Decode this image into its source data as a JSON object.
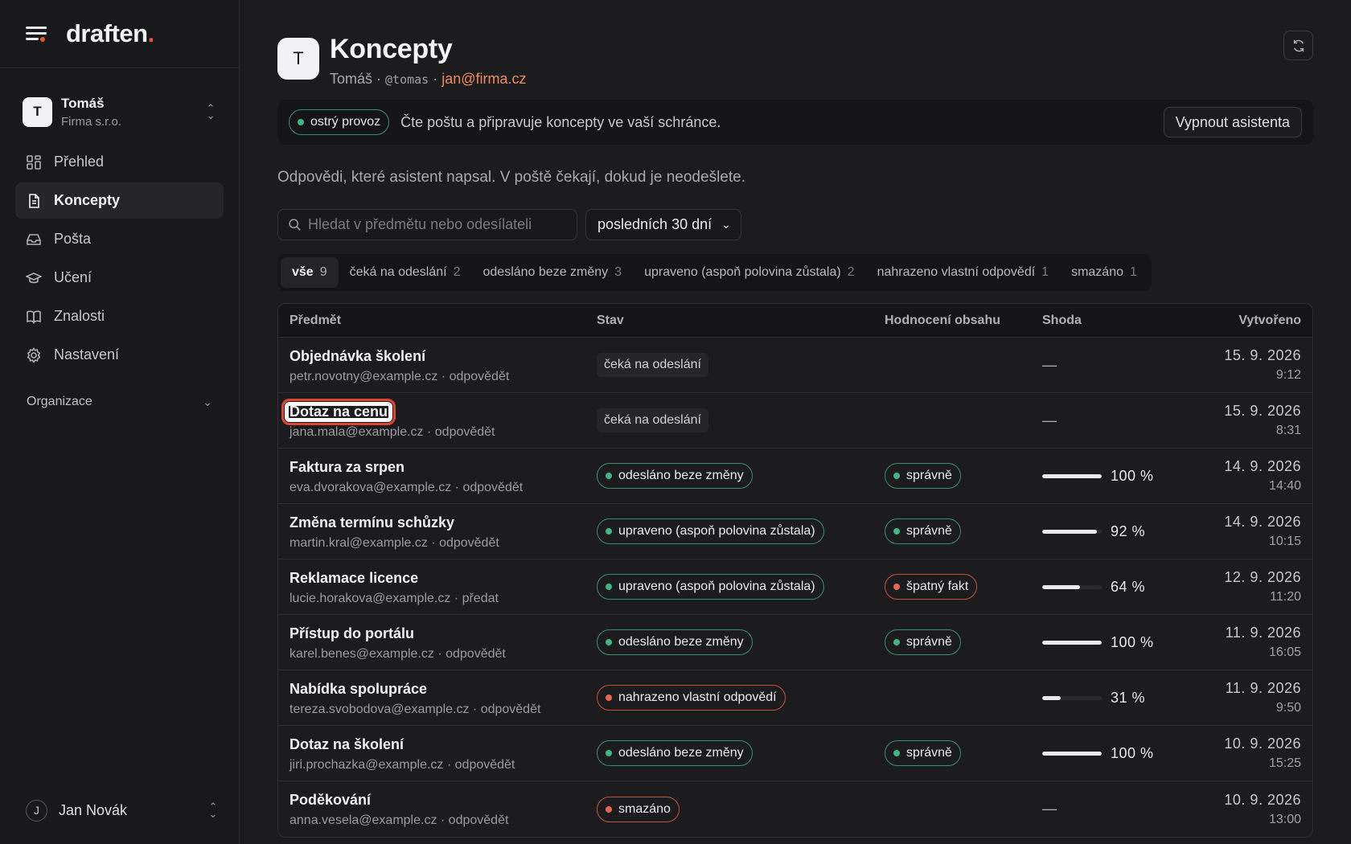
{
  "app": {
    "logo_text": "draften",
    "logo_accent": ".",
    "accent_color": "#e8552f"
  },
  "account": {
    "initial": "T",
    "name": "Tomáš",
    "org": "Firma s.r.o."
  },
  "nav": [
    {
      "label": "Přehled",
      "icon": "grid-icon"
    },
    {
      "label": "Koncepty",
      "icon": "document-icon",
      "active": true
    },
    {
      "label": "Pošta",
      "icon": "inbox-icon"
    },
    {
      "label": "Učení",
      "icon": "graduation-cap-icon"
    },
    {
      "label": "Znalosti",
      "icon": "book-icon"
    },
    {
      "label": "Nastavení",
      "icon": "gear-icon"
    }
  ],
  "org_section": {
    "label": "Organizace"
  },
  "user": {
    "initial": "J",
    "name": "Jan Novák"
  },
  "header": {
    "avatar_initial": "T",
    "title": "Koncepty",
    "name": "Tomáš",
    "sep1": " · ",
    "handle": "@tomas",
    "sep2": " · ",
    "email": "jan@firma.cz"
  },
  "status_bar": {
    "badge": "ostrý provoz",
    "text": "Čte poštu a připravuje koncepty ve vaší schránce.",
    "button": "Vypnout asistenta"
  },
  "intro": "Odpovědi, které asistent napsal. V poště čekají, dokud je neodešlete.",
  "search": {
    "placeholder": "Hledat v předmětu nebo odesílateli",
    "value": ""
  },
  "period_select": {
    "value": "posledních 30 dní"
  },
  "filters": [
    {
      "label": "vše",
      "count": "9",
      "active": true
    },
    {
      "label": "čeká na odeslání",
      "count": "2"
    },
    {
      "label": "odesláno beze změny",
      "count": "3"
    },
    {
      "label": "upraveno (aspoň polovina zůstala)",
      "count": "2"
    },
    {
      "label": "nahrazeno vlastní odpovědí",
      "count": "1"
    },
    {
      "label": "smazáno",
      "count": "1"
    }
  ],
  "table": {
    "columns": [
      "Předmět",
      "Stav",
      "Hodnocení obsahu",
      "Shoda",
      "Vytvořeno"
    ],
    "rows": [
      {
        "subject": "Objednávka školení",
        "from": "petr.novotny@example.cz",
        "action": "odpovědět",
        "status": "čeká na odeslání",
        "status_kind": "neutral",
        "rating": "",
        "rating_kind": "",
        "match": null,
        "match_text": "—",
        "date": "15. 9. 2026",
        "time": "9:12"
      },
      {
        "subject": "Dotaz na cenu",
        "from": "jana.mala@example.cz",
        "action": "odpovědět",
        "status": "čeká na odeslání",
        "status_kind": "neutral",
        "rating": "",
        "rating_kind": "",
        "match": null,
        "match_text": "—",
        "date": "15. 9. 2026",
        "time": "8:31",
        "highlight": true
      },
      {
        "subject": "Faktura za srpen",
        "from": "eva.dvorakova@example.cz",
        "action": "odpovědět",
        "status": "odesláno beze změny",
        "status_kind": "green",
        "rating": "správně",
        "rating_kind": "green",
        "match": 100,
        "match_text": "100 %",
        "date": "14. 9. 2026",
        "time": "14:40"
      },
      {
        "subject": "Změna termínu schůzky",
        "from": "martin.kral@example.cz",
        "action": "odpovědět",
        "status": "upraveno (aspoň polovina zůstala)",
        "status_kind": "green",
        "rating": "správně",
        "rating_kind": "green",
        "match": 92,
        "match_text": "92 %",
        "date": "14. 9. 2026",
        "time": "10:15"
      },
      {
        "subject": "Reklamace licence",
        "from": "lucie.horakova@example.cz",
        "action": "předat",
        "status": "upraveno (aspoň polovina zůstala)",
        "status_kind": "green",
        "rating": "špatný fakt",
        "rating_kind": "red",
        "match": 64,
        "match_text": "64 %",
        "date": "12. 9. 2026",
        "time": "11:20"
      },
      {
        "subject": "Přístup do portálu",
        "from": "karel.benes@example.cz",
        "action": "odpovědět",
        "status": "odesláno beze změny",
        "status_kind": "green",
        "rating": "správně",
        "rating_kind": "green",
        "match": 100,
        "match_text": "100 %",
        "date": "11. 9. 2026",
        "time": "16:05"
      },
      {
        "subject": "Nabídka spolupráce",
        "from": "tereza.svobodova@example.cz",
        "action": "odpovědět",
        "status": "nahrazeno vlastní odpovědí",
        "status_kind": "red",
        "rating": "",
        "rating_kind": "",
        "match": 31,
        "match_text": "31 %",
        "date": "11. 9. 2026",
        "time": "9:50"
      },
      {
        "subject": "Dotaz na školení",
        "from": "jiri.prochazka@example.cz",
        "action": "odpovědět",
        "status": "odesláno beze změny",
        "status_kind": "green",
        "rating": "správně",
        "rating_kind": "green",
        "match": 100,
        "match_text": "100 %",
        "date": "10. 9. 2026",
        "time": "15:25"
      },
      {
        "subject": "Poděkování",
        "from": "anna.vesela@example.cz",
        "action": "odpovědět",
        "status": "smazáno",
        "status_kind": "red",
        "rating": "",
        "rating_kind": "",
        "match": null,
        "match_text": "—",
        "date": "10. 9. 2026",
        "time": "13:00"
      }
    ]
  }
}
